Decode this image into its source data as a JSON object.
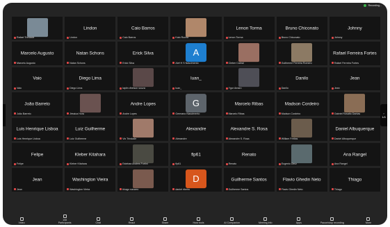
{
  "status": {
    "recording_label": "Recording..."
  },
  "tiles": [
    {
      "big": "",
      "label": "Rafael Trindade",
      "photo": "#7a8a96"
    },
    {
      "big": "Lindon",
      "label": "Lindon"
    },
    {
      "big": "Caio Barros",
      "label": "Caio Barros"
    },
    {
      "big": "",
      "label": "Kaio Rocha",
      "photo": "#b0876a"
    },
    {
      "big": "Lenon Torma",
      "label": "Lenon Torma"
    },
    {
      "big": "Bruno Chiconato",
      "label": "Bruno Chiconato"
    },
    {
      "big": "Johnny",
      "label": "Johnny"
    },
    {
      "big": "Marcelo Augusto",
      "label": "Marcelo Augusto"
    },
    {
      "big": "Natan Schons",
      "label": "Natan Schons"
    },
    {
      "big": "Erick Silva",
      "label": "Erick Silva"
    },
    {
      "big": "",
      "label": "Alef H S Nascimento",
      "avatar": "A",
      "avatar_color": "#1e7fd0"
    },
    {
      "big": "",
      "label": "Cleber Cabral",
      "photo": "#9a6f62"
    },
    {
      "big": "",
      "label": "Guilherme Ferreira Romero",
      "photo": "#8c7a64"
    },
    {
      "big": "Rafael Ferreira Fortes",
      "label": "Rafael Ferreira Fortes"
    },
    {
      "big": "Vaio",
      "label": "Vaio"
    },
    {
      "big": "Diego Lima",
      "label": "Diego Lima"
    },
    {
      "big": "",
      "label": "lapiin dheison souza",
      "photo": "#5a4848"
    },
    {
      "big": "luan_",
      "label": "luan_"
    },
    {
      "big": "",
      "label": "Ygor Amaro",
      "photo": "#4e4e56"
    },
    {
      "big": "Danilo",
      "label": "Danilo"
    },
    {
      "big": "Jean",
      "label": "Jean"
    },
    {
      "big": "João Barreto",
      "label": "João Barreto"
    },
    {
      "big": "",
      "label": "Jéssica Hora",
      "photo": "#6a5250"
    },
    {
      "big": "Andre Lopes",
      "label": "Andre Lopes"
    },
    {
      "big": "",
      "label": "Germano Nascimento",
      "avatar": "G",
      "avatar_color": "#5d646b"
    },
    {
      "big": "Marcelo Ribas",
      "label": "Marcelo Ribas"
    },
    {
      "big": "Madson Cordeiro",
      "label": "Madson Cordeiro"
    },
    {
      "big": "",
      "label": "Gabriel Rosatto Dantas",
      "photo": "#8a6d55"
    },
    {
      "big": "Luis Henrique Lisboa",
      "label": "Luis Henrique Lisboa"
    },
    {
      "big": "Luiz Guilherme",
      "label": "Luiz Guilherme"
    },
    {
      "big": "",
      "label": "Vix Trindade",
      "photo": "#a07a6a"
    },
    {
      "big": "Alexandre",
      "label": "Alexandre"
    },
    {
      "big": "Alexandre S. Rosa",
      "label": "Alexandre S. Rosa"
    },
    {
      "big": "",
      "label": "William Freitas",
      "photo": "#6b5c4c"
    },
    {
      "big": "Daniel Albuquerque",
      "label": "Daniel Albuquerque"
    },
    {
      "big": "Felipe",
      "label": "Felipe"
    },
    {
      "big": "Kleber Kitahara",
      "label": "Kleber Kitahara"
    },
    {
      "big": "",
      "label": "Esteban Andres Fortini",
      "photo": "#4a4a42"
    },
    {
      "big": "flp61",
      "label": "flp61"
    },
    {
      "big": "Renato",
      "label": "Renato"
    },
    {
      "big": "",
      "label": "Eugenio Diniz",
      "photo": "#5a6a6e"
    },
    {
      "big": "Ana Rangel",
      "label": "Ana Rangel"
    },
    {
      "big": "Jean",
      "label": "Jean"
    },
    {
      "big": "Washington Vieira",
      "label": "Washington Vieira"
    },
    {
      "big": "",
      "label": "thiago navarro",
      "photo": "#7a5a4e"
    },
    {
      "big": "",
      "label": "daniel ribeiro",
      "avatar": "D",
      "avatar_color": "#d7561c"
    },
    {
      "big": "Guilherme Santos",
      "label": "Guilherme Santos"
    },
    {
      "big": "Flavio Ghedin Neto",
      "label": "Flavio Ghedin Neto"
    },
    {
      "big": "Thiago",
      "label": "Thiago"
    }
  ],
  "toolbar": [
    {
      "label": "Video",
      "icon": "video-icon"
    },
    {
      "label": "Participants",
      "icon": "participants-icon"
    },
    {
      "label": "Chat",
      "icon": "chat-icon"
    },
    {
      "label": "React",
      "icon": "react-icon"
    },
    {
      "label": "Share",
      "icon": "share-icon"
    },
    {
      "label": "Host tools",
      "icon": "host-tools-icon"
    },
    {
      "label": "AI Companion",
      "icon": "ai-companion-icon"
    },
    {
      "label": "Meeting info",
      "icon": "info-icon"
    },
    {
      "label": "Apps",
      "icon": "apps-icon"
    },
    {
      "label": "Pause/stop recording",
      "icon": "recording-icon"
    },
    {
      "label": "More",
      "icon": "more-icon"
    }
  ],
  "participant_count": "108",
  "page_indicator": "1/4"
}
